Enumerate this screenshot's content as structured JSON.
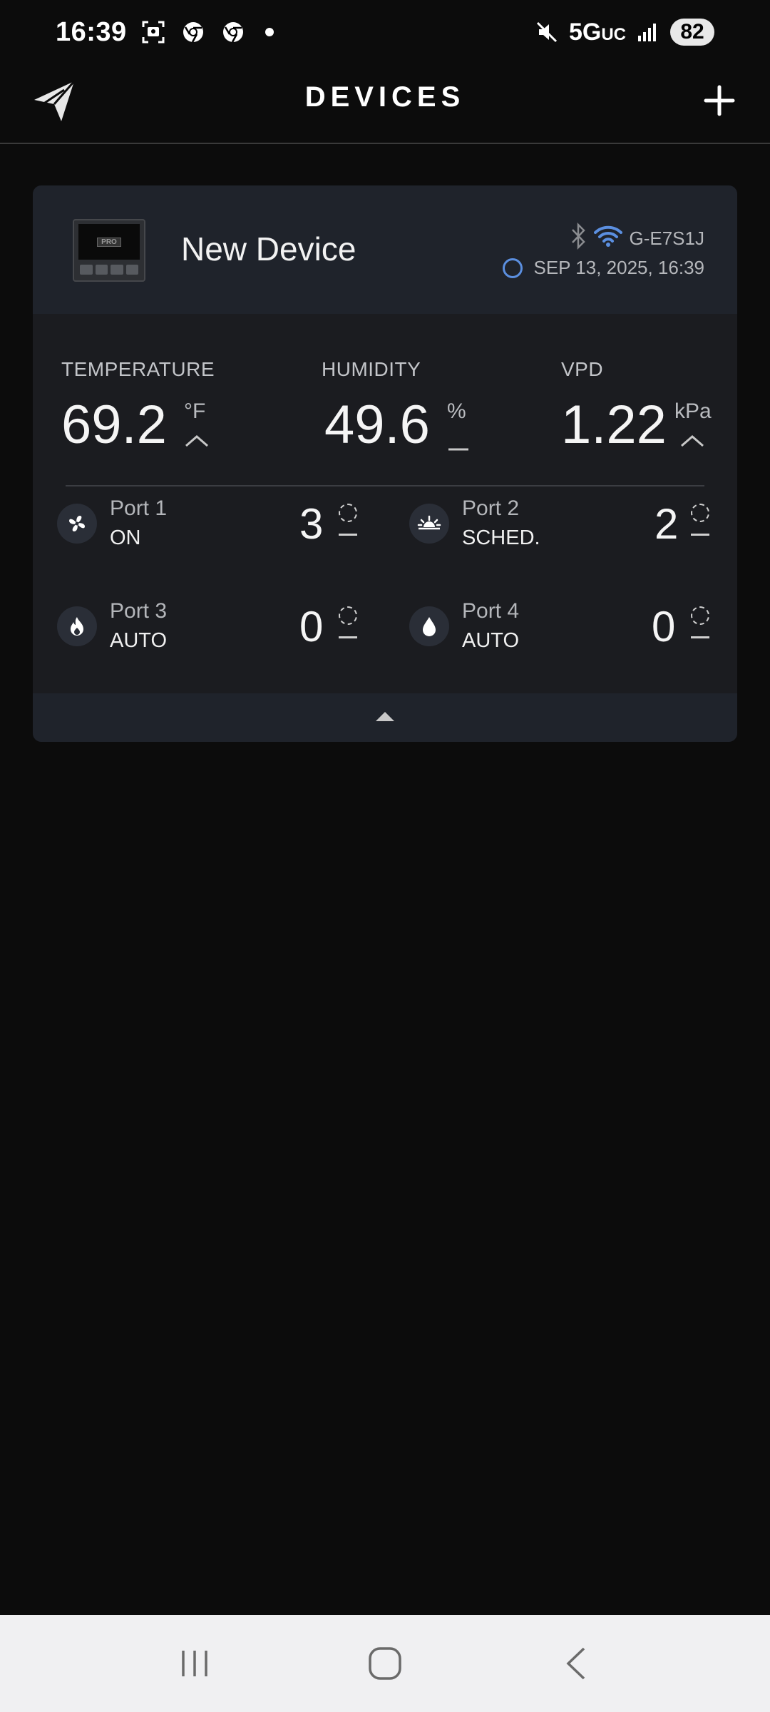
{
  "status_bar": {
    "time": "16:39",
    "network": "5G",
    "network_suffix": "UC",
    "battery": "82"
  },
  "header": {
    "title": "DEVICES"
  },
  "device": {
    "name": "New Device",
    "device_id": "G-E7S1J",
    "timestamp": "SEP 13, 2025, 16:39",
    "thumb_label": "PRO",
    "readings": {
      "temperature": {
        "label": "TEMPERATURE",
        "value": "69.2",
        "unit": "°F"
      },
      "humidity": {
        "label": "HUMIDITY",
        "value": "49.6",
        "unit": "%"
      },
      "vpd": {
        "label": "VPD",
        "value": "1.22",
        "unit": "kPa"
      }
    },
    "ports": [
      {
        "name": "Port 1",
        "mode": "ON",
        "level": "3",
        "icon": "fan-icon"
      },
      {
        "name": "Port 2",
        "mode": "SCHED.",
        "level": "2",
        "icon": "sun-icon"
      },
      {
        "name": "Port 3",
        "mode": "AUTO",
        "level": "0",
        "icon": "flame-icon"
      },
      {
        "name": "Port 4",
        "mode": "AUTO",
        "level": "0",
        "icon": "droplet-icon"
      }
    ]
  },
  "colors": {
    "background": "#0c0c0c",
    "card": "#1b1c20",
    "card_header": "#1f232b",
    "wifi": "#5b8fe0",
    "nav_bar": "#f0f0f2"
  }
}
